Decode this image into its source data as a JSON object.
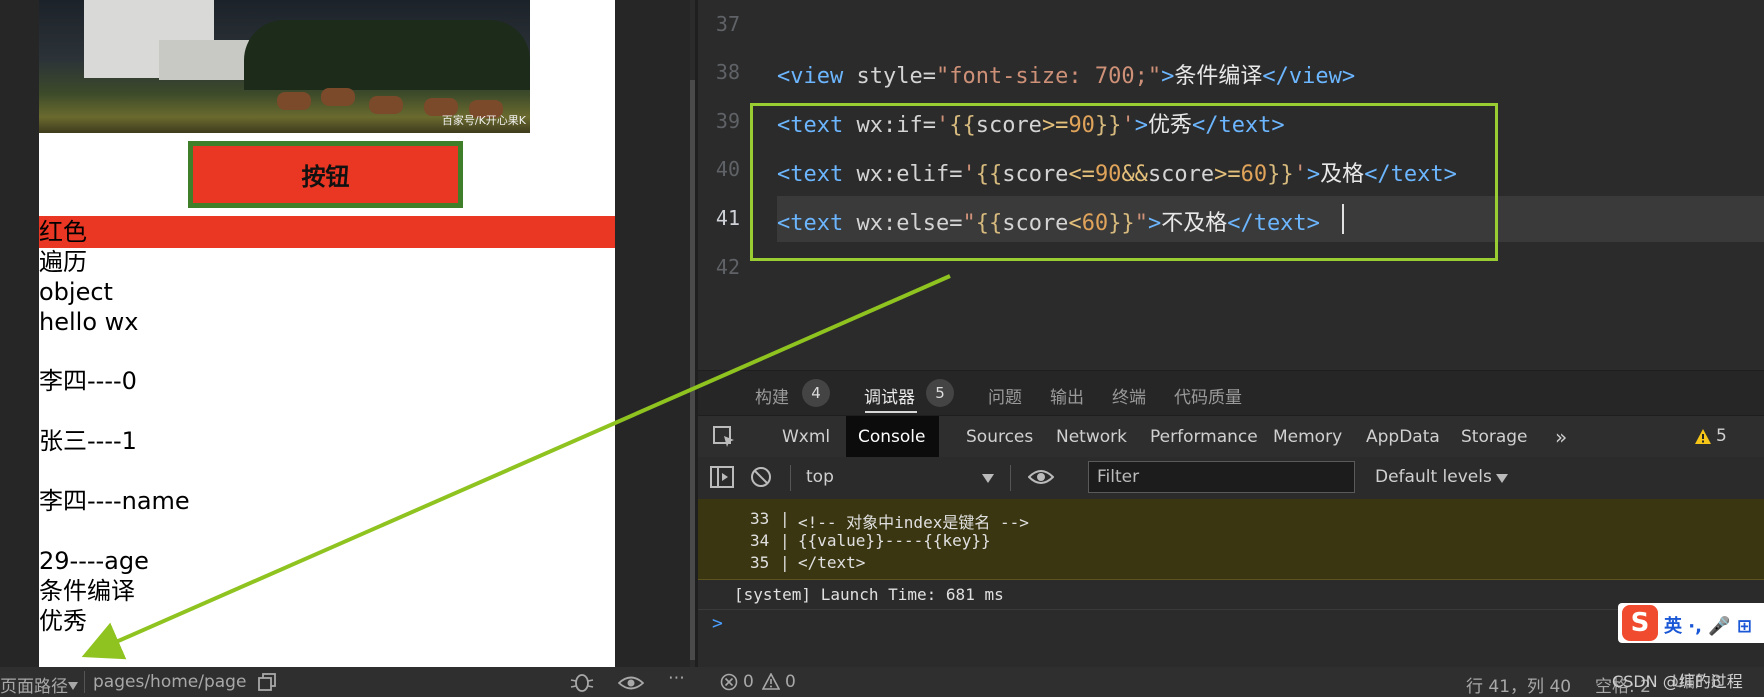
{
  "simulator": {
    "photo_watermark": "百家号/K开心果K",
    "button_label": "按钮",
    "lines": [
      "红色",
      "遍历",
      "object",
      "hello wx",
      "李四----0",
      "张三----1",
      "李四----name",
      "29----age",
      "条件编译",
      "优秀"
    ]
  },
  "status_bar": {
    "page_path_label": "页面路径",
    "page_path": "pages/home/page",
    "errors": "0",
    "warnings": "0",
    "cursor": "行 41，列 40",
    "indent": "空格: 2",
    "encoding": "UTF-8"
  },
  "editor": {
    "line_numbers": [
      "37",
      "38",
      "39",
      "40",
      "41",
      "42"
    ],
    "code": {
      "l38_open": "<view",
      "l38_attr": " style=",
      "l38_str": "\"font-size: 700;\"",
      "l38_gt": ">",
      "l38_text": "条件编译",
      "l38_close": "</view>",
      "l39_open": "<text",
      "l39_attr": " wx:if=",
      "l39_q1": "'",
      "l39_b1": "{{",
      "l39_var": "score",
      "l39_op": ">=",
      "l39_num": "90",
      "l39_b2": "}}",
      "l39_q2": "'",
      "l39_gt": ">",
      "l39_text": "优秀",
      "l39_close": "</text>",
      "l40_open": "<text",
      "l40_attr": " wx:elif=",
      "l40_q1": "'",
      "l40_b1": "{{",
      "l40_var1": "score",
      "l40_op1": "<=",
      "l40_num1": "90",
      "l40_and": "&&",
      "l40_var2": "score",
      "l40_op2": ">=",
      "l40_num2": "60",
      "l40_b2": "}}",
      "l40_q2": "'",
      "l40_gt": ">",
      "l40_text": "及格",
      "l40_close": "</text>",
      "l41_open": "<text",
      "l41_attr": " wx:else=",
      "l41_q1": "\"",
      "l41_b1": "{{",
      "l41_var": "score",
      "l41_op": "<",
      "l41_num": "60",
      "l41_b2": "}}",
      "l41_q2": "\"",
      "l41_gt": ">",
      "l41_text": "不及格",
      "l41_close": "</text>"
    }
  },
  "panel_tabs": [
    {
      "label": "构建",
      "badge": "4"
    },
    {
      "label": "调试器",
      "badge": "5"
    },
    {
      "label": "问题"
    },
    {
      "label": "输出"
    },
    {
      "label": "终端"
    },
    {
      "label": "代码质量"
    }
  ],
  "devtools": {
    "tabs": [
      "Wxml",
      "Console",
      "Sources",
      "Network",
      "Performance",
      "Memory",
      "AppData",
      "Storage"
    ],
    "more": "»",
    "warning_count": "5",
    "context": "top",
    "filter_placeholder": "Filter",
    "levels": "Default levels"
  },
  "console": {
    "lines": [
      {
        "num": "33",
        "text": "<!-- 对象中index是键名 -->"
      },
      {
        "num": "34",
        "text": "{{value}}----{{key}}"
      },
      {
        "num": "35",
        "text": "</text>"
      }
    ],
    "system": "[system] Launch Time: 681 ms",
    "prompt": ">"
  },
  "ime": {
    "logo": "S",
    "text": "英 ·, 🎤 ⊞"
  },
  "watermark": "CSDN @编的过程"
}
